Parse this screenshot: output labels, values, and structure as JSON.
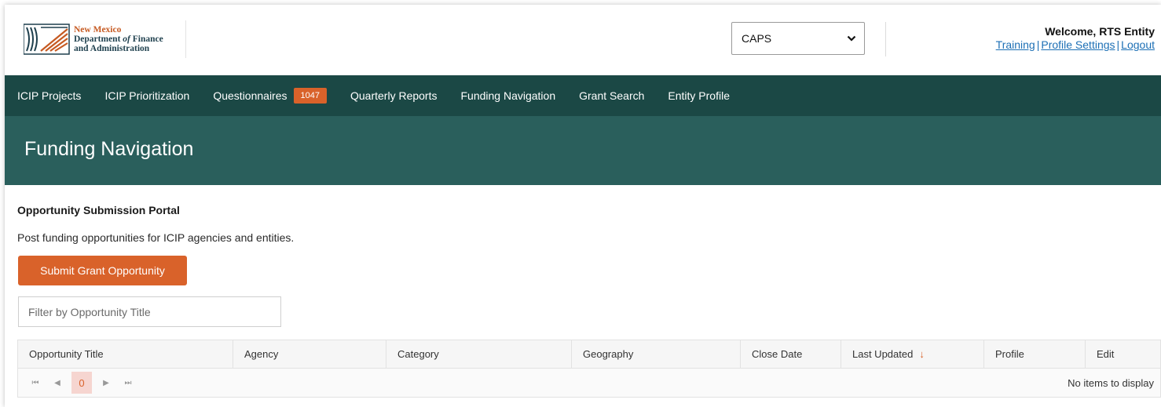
{
  "header": {
    "logo": {
      "line1": "New Mexico",
      "line2_a": "Department ",
      "line2_b": "of",
      "line2_c": " Finance",
      "line3": "and Administration"
    },
    "app_select": {
      "selected": "CAPS"
    },
    "welcome": "Welcome, RTS Entity",
    "links": {
      "training": "Training",
      "profile_settings": "Profile Settings",
      "logout": "Logout",
      "separator": "|"
    }
  },
  "nav": {
    "items": [
      {
        "label": "ICIP Projects"
      },
      {
        "label": "ICIP Prioritization"
      },
      {
        "label": "Questionnaires",
        "badge": "1047"
      },
      {
        "label": "Quarterly Reports"
      },
      {
        "label": "Funding Navigation"
      },
      {
        "label": "Grant Search"
      },
      {
        "label": "Entity Profile"
      }
    ]
  },
  "banner": {
    "title": "Funding Navigation"
  },
  "main": {
    "section_title": "Opportunity Submission Portal",
    "section_desc": "Post funding opportunities for ICIP agencies and entities.",
    "submit_label": "Submit Grant Opportunity",
    "filter_placeholder": "Filter by Opportunity Title",
    "grid": {
      "columns": [
        {
          "label": "Opportunity Title"
        },
        {
          "label": "Agency"
        },
        {
          "label": "Category"
        },
        {
          "label": "Geography"
        },
        {
          "label": "Close Date"
        },
        {
          "label": "Last Updated",
          "sort": "↓"
        },
        {
          "label": "Profile"
        },
        {
          "label": "Edit"
        }
      ],
      "pager": {
        "first": "⏮",
        "prev": "◀",
        "current": "0",
        "next": "▶",
        "last": "⏭"
      },
      "empty_message": "No items to display"
    }
  },
  "colors": {
    "nav_bg": "#1b4845",
    "banner_bg": "#2a5f5c",
    "accent": "#d9622a",
    "link": "#1c6fb5"
  }
}
